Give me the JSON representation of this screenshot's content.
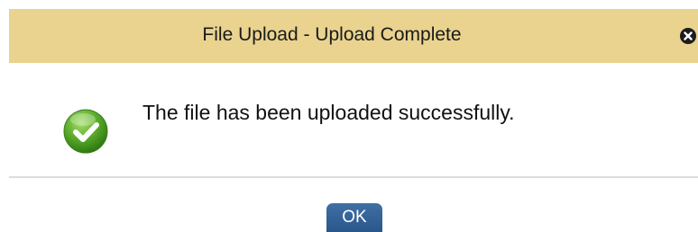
{
  "dialog": {
    "title": "File Upload - Upload Complete",
    "close_icon": "close-icon",
    "message": "The file has been uploaded successfully.",
    "status_icon": "checkmark-icon",
    "ok_label": "OK"
  },
  "colors": {
    "titlebar_bg": "#e9d38f",
    "success_green": "#5aaa2a",
    "ok_button_bg": "#33639a"
  }
}
